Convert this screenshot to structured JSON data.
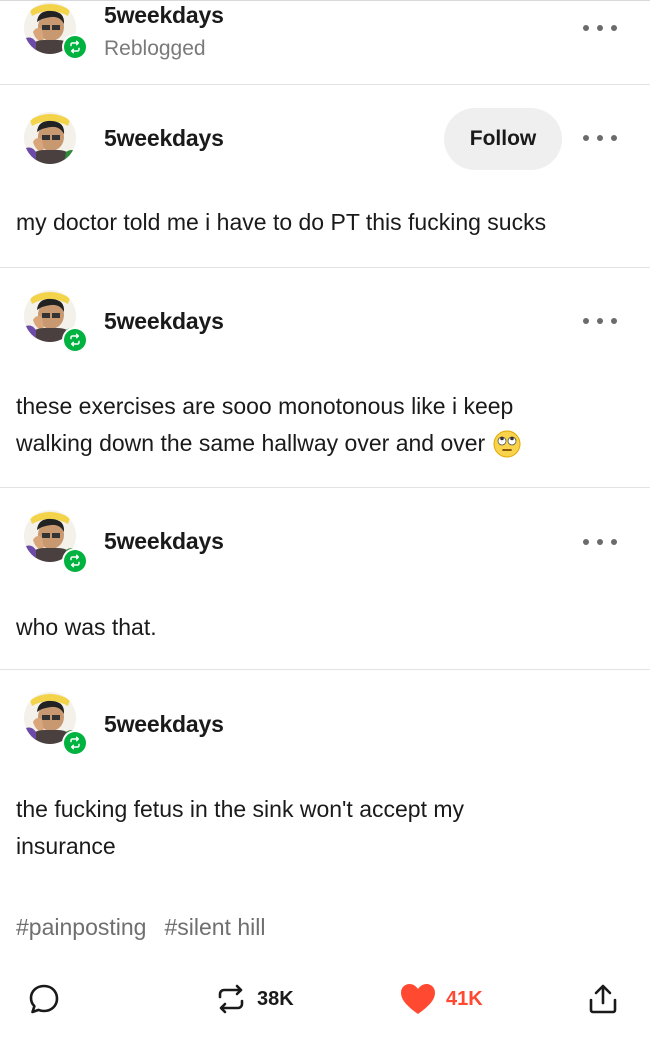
{
  "header_post": {
    "username": "5weekdays",
    "status": "Reblogged"
  },
  "posts": [
    {
      "username": "5weekdays",
      "follow_label": "Follow",
      "text": "my doctor told me i have to do PT this fucking sucks"
    },
    {
      "username": "5weekdays",
      "text_line1": "these exercises are sooo monotonous like i keep",
      "text_line2": "walking down the same hallway over and over",
      "emoji": "rolling-eyes-emoji"
    },
    {
      "username": "5weekdays",
      "text": "who was that."
    },
    {
      "username": "5weekdays",
      "text_line1": "the fucking fetus in the sink won't accept my",
      "text_line2": "insurance"
    }
  ],
  "tags": [
    "#painposting",
    "#silent hill"
  ],
  "actions": {
    "reblog_count": "38K",
    "like_count": "41K"
  },
  "colors": {
    "reblog_green": "#00b23f",
    "like_red": "#ff4930",
    "follow_bg": "#efefef"
  },
  "icons": [
    "more-icon",
    "reblog-badge-icon",
    "comment-icon",
    "reblog-icon",
    "heart-icon",
    "share-icon"
  ]
}
